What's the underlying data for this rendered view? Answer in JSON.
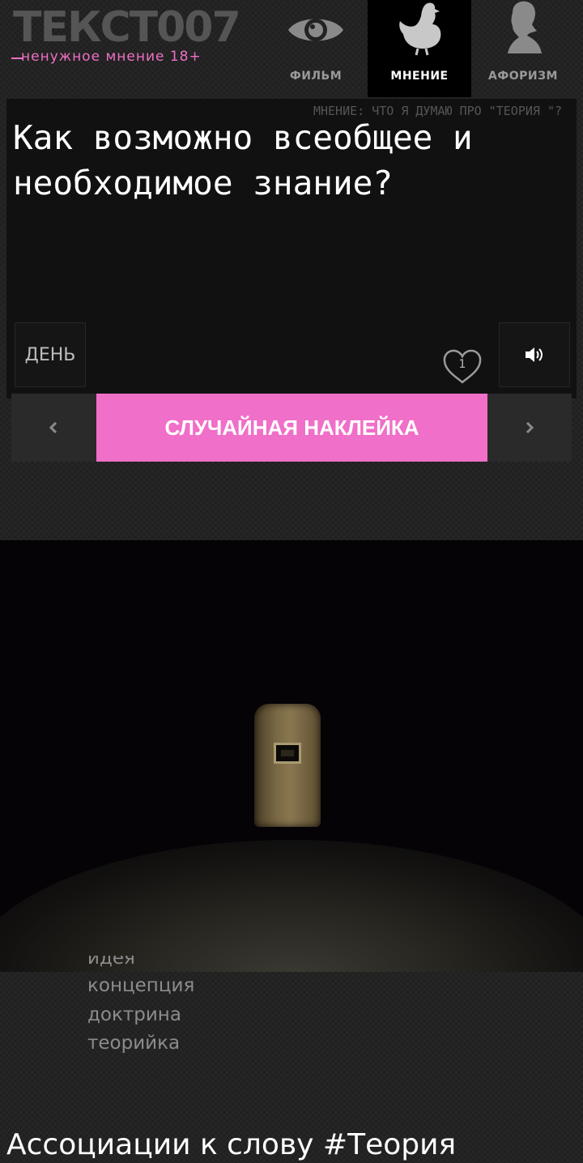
{
  "logo": {
    "title": "ТЕКСТ007",
    "subtitle": "ненужное мнение 18+"
  },
  "nav": {
    "tabs": [
      {
        "label": "ФИЛЬМ",
        "icon": "eye-icon",
        "active": false
      },
      {
        "label": "МНЕНИЕ",
        "icon": "chicken-icon",
        "active": true
      },
      {
        "label": "АФОРИЗМ",
        "icon": "bust-silhouette-icon",
        "active": false
      }
    ]
  },
  "card": {
    "breadcrumb": "МНЕНИЕ: ЧТО Я ДУМАЮ ПРО \"ТЕОРИЯ \"?",
    "quote": "Как возможно всеобщее и необходимое знание?",
    "day_label": "ДЕНЬ",
    "like_count": "1",
    "sound_icon": "speaker-icon"
  },
  "random_bar": {
    "prev_icon": "chevron-left-icon",
    "next_icon": "chevron-right-icon",
    "button_label": "СЛУЧАЙНАЯ НАКЛЕЙКА"
  },
  "synonyms": {
    "items": [
      "концепция",
      "доктрина",
      "теорийка"
    ]
  },
  "associations": {
    "title": "Ассоциации к слову #Теория"
  },
  "colors": {
    "accent": "#f06fc8",
    "background": "#232323",
    "card": "#111111"
  }
}
